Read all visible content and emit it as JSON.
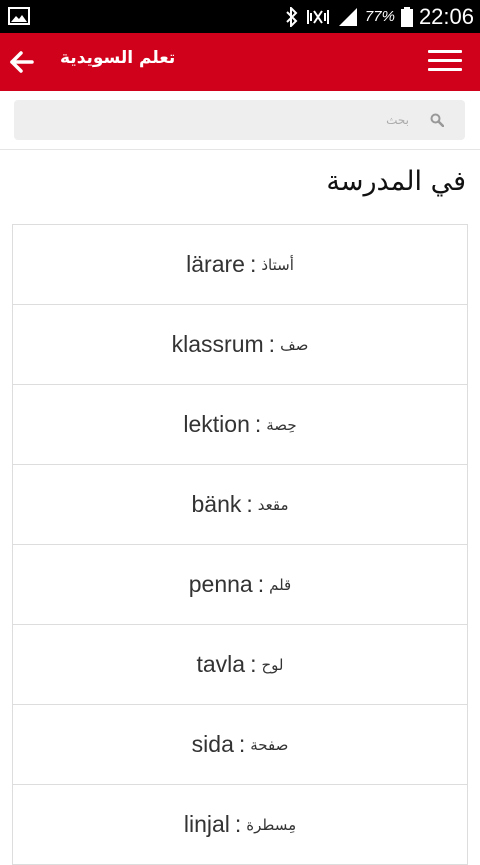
{
  "status_bar": {
    "battery_percent": "77%",
    "time": "22:06",
    "icons": [
      "gallery-icon",
      "bluetooth-icon",
      "mute-icon",
      "signal-icon",
      "battery-icon"
    ]
  },
  "app_bar": {
    "title": "تعلم السويدية",
    "icons": [
      "menu-icon",
      "back-arrow-icon"
    ],
    "background": "#d0021b"
  },
  "search": {
    "placeholder": "بحث",
    "icon": "search-icon"
  },
  "page": {
    "title": "في المدرسة"
  },
  "words": [
    {
      "swedish": "lärare",
      "separator": ":",
      "arabic": "أستاذ"
    },
    {
      "swedish": "klassrum",
      "separator": ":",
      "arabic": "صف"
    },
    {
      "swedish": "lektion",
      "separator": ":",
      "arabic": "حِصة"
    },
    {
      "swedish": "bänk",
      "separator": ":",
      "arabic": "مقعد"
    },
    {
      "swedish": "penna",
      "separator": ":",
      "arabic": "قلم"
    },
    {
      "swedish": "tavla",
      "separator": ":",
      "arabic": "لوح"
    },
    {
      "swedish": "sida",
      "separator": ":",
      "arabic": "صفحة"
    },
    {
      "swedish": "linjal",
      "separator": ":",
      "arabic": "مِسطرة"
    }
  ]
}
